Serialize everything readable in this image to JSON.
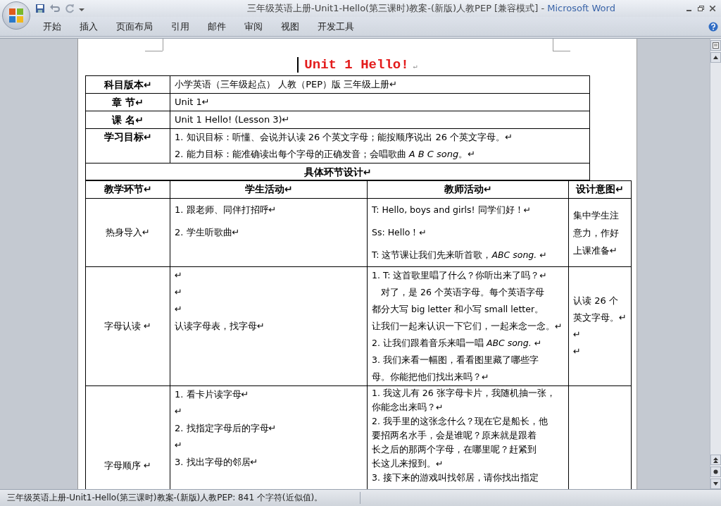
{
  "window": {
    "title": "三年级英语上册-Unit1-Hello(第三课时)教案-(新版)人教PEP [兼容模式]",
    "separator": "-",
    "app_name": "Microsoft Word"
  },
  "ribbon_tabs": [
    {
      "label": "开始"
    },
    {
      "label": "插入"
    },
    {
      "label": "页面布局"
    },
    {
      "label": "引用"
    },
    {
      "label": "邮件"
    },
    {
      "label": "审阅"
    },
    {
      "label": "视图"
    },
    {
      "label": "开发工具"
    }
  ],
  "document": {
    "title": "Unit 1 Hello!",
    "title_mark": "↵",
    "info_rows": [
      {
        "label": "科目版本↵",
        "lines": [
          "小学英语（三年级起点） 人教（PEP）版 三年级上册↵"
        ]
      },
      {
        "label": "章 节↵",
        "lines": [
          "Unit 1↵"
        ]
      },
      {
        "label": "课 名↵",
        "lines": [
          "Unit 1 Hello! (Lesson 3)↵"
        ]
      },
      {
        "label": "学习目标↵",
        "lines": [
          "1. 知识目标：听懂、会说并认读 26 个英文字母；能按顺序说出 26 个英文字母。↵",
          "2. 能力目标：能准确读出每个字母的正确发音；会唱歌曲 *A B C song*。↵"
        ]
      }
    ],
    "section_heading": "具体环节设计↵",
    "columns": [
      "教学环节↵",
      "学生活动↵",
      "教师活动↵",
      "设计意图↵"
    ],
    "rows": [
      {
        "cells": [
          [
            "热身导入↵"
          ],
          [
            "1. 跟老师、同伴打招呼↵",
            "2. 学生听歌曲↵"
          ],
          [
            "T: Hello, boys and girls! 同学们好！↵",
            "Ss: Hello！↵",
            "T: 这节课让我们先来听首歌，*ABC song.* ↵"
          ],
          [
            "集中学生注",
            "意力，作好",
            "上课准备↵"
          ]
        ]
      },
      {
        "cells": [
          [
            "字母认读 ↵"
          ],
          [
            "↵",
            "↵",
            "↵",
            "认读字母表，找字母↵"
          ],
          [
            "1. T: 这首歌里唱了什么？你听出来了吗？↵",
            "　对了，是 26 个英语字母。每个英语字母",
            "都分大写 big letter 和小写 small letter。",
            "让我们一起来认识一下它们，一起来念一念。↵",
            "2. 让我们跟着音乐来唱一唱 *ABC song.* ↵",
            "3. 我们来看一幅图，看看图里藏了哪些字",
            "母。你能把他们找出来吗？↵"
          ],
          [
            "认读 26 个",
            "英文字母。↵",
            "↵",
            "↵"
          ]
        ]
      },
      {
        "cells": [
          [
            "字母顺序 ↵"
          ],
          [
            "1. 看卡片读字母↵",
            "↵",
            "2. 找指定字母后的字母↵",
            "↵",
            "3. 找出字母的邻居↵"
          ],
          [
            "1. 我这儿有 26 张字母卡片，我随机抽一张，",
            "你能念出来吗？↵",
            "2. 我手里的这张念什么？现在它是船长，他",
            "要招两名水手，会是谁呢？原来就是跟着",
            "长之后的那两个字母，在哪里呢？赶紧到",
            "长这儿来报到。↵",
            "3. 接下来的游戏叫找邻居，请你找出指定"
          ],
          []
        ]
      }
    ]
  },
  "status_bar": {
    "text": "三年级英语上册-Unit1-Hello(第三课时)教案-(新版)人教PEP: 841 个字符(近似值)。"
  }
}
